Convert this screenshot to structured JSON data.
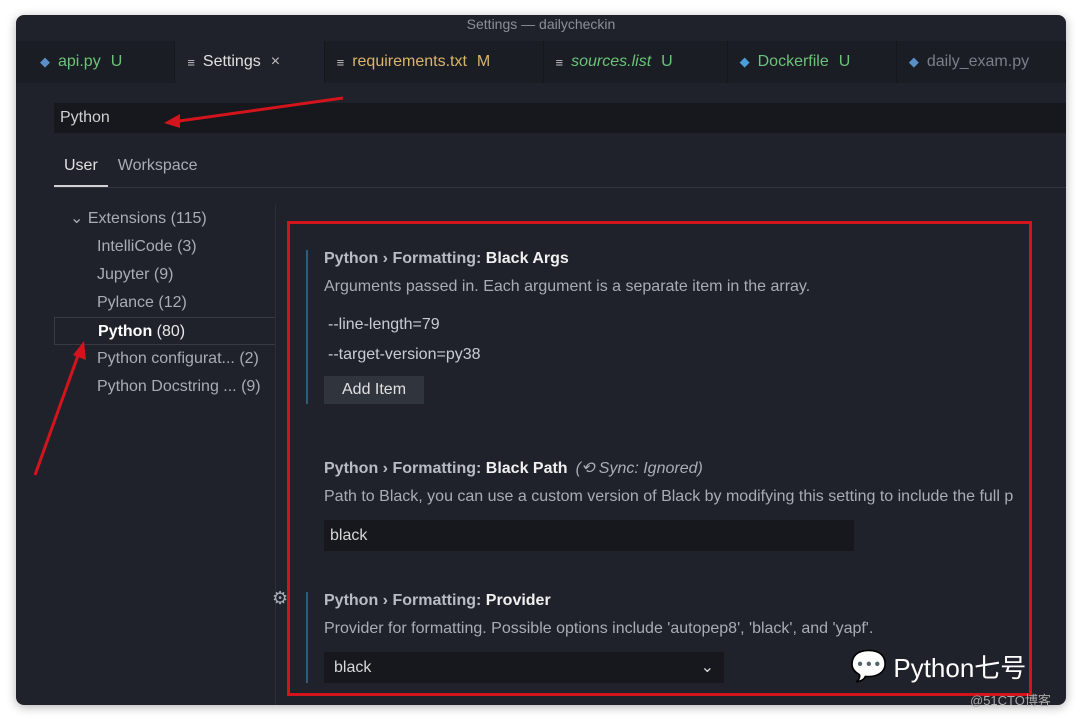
{
  "window": {
    "title": "Settings — dailycheckin"
  },
  "tabs": [
    {
      "label": "api.py",
      "status": "U",
      "color": "#6cc27a",
      "icon": "python-icon",
      "italic": false
    },
    {
      "label": "Settings",
      "status": "×",
      "color": "#e0e0e0",
      "icon": "settings-file-icon",
      "italic": false
    },
    {
      "label": "requirements.txt",
      "status": "M",
      "color": "#d9b56e",
      "icon": "text-file-icon",
      "italic": false
    },
    {
      "label": "sources.list",
      "status": "U",
      "color": "#6cc27a",
      "icon": "text-file-icon",
      "italic": true
    },
    {
      "label": "Dockerfile",
      "status": "U",
      "color": "#6cc27a",
      "icon": "docker-icon",
      "italic": false
    },
    {
      "label": "daily_exam.py",
      "status": "",
      "color": "#7a7f88",
      "icon": "python-icon",
      "italic": false
    }
  ],
  "search": {
    "value": "Python"
  },
  "scope_tabs": [
    "User",
    "Workspace"
  ],
  "sidebar": {
    "root": "Extensions (115)",
    "items": [
      {
        "name": "IntelliCode",
        "count": "(3)"
      },
      {
        "name": "Jupyter",
        "count": "(9)"
      },
      {
        "name": "Pylance",
        "count": "(12)"
      },
      {
        "name": "Python",
        "count": "(80)"
      },
      {
        "name": "Python configurat...",
        "count": "(2)"
      },
      {
        "name": "Python Docstring ...",
        "count": "(9)"
      }
    ]
  },
  "settings": {
    "black_args": {
      "prefix": "Python › Formatting: ",
      "name": "Black Args",
      "desc": "Arguments passed in. Each argument is a separate item in the array.",
      "items": [
        "--line-length=79",
        "--target-version=py38"
      ],
      "add_label": "Add Item"
    },
    "black_path": {
      "prefix": "Python › Formatting: ",
      "name": "Black Path",
      "sync": "Sync: Ignored)",
      "desc": "Path to Black, you can use a custom version of Black by modifying this setting to include the full p",
      "value": "black"
    },
    "provider": {
      "prefix": "Python › Formatting: ",
      "name": "Provider",
      "desc": "Provider for formatting. Possible options include 'autopep8', 'black', and 'yapf'.",
      "value": "black"
    }
  },
  "watermark": {
    "text": "Python七号",
    "site": "@51CTO博客"
  },
  "colors": {
    "annotation": "#d3141c",
    "accent": "#2a5d80"
  }
}
